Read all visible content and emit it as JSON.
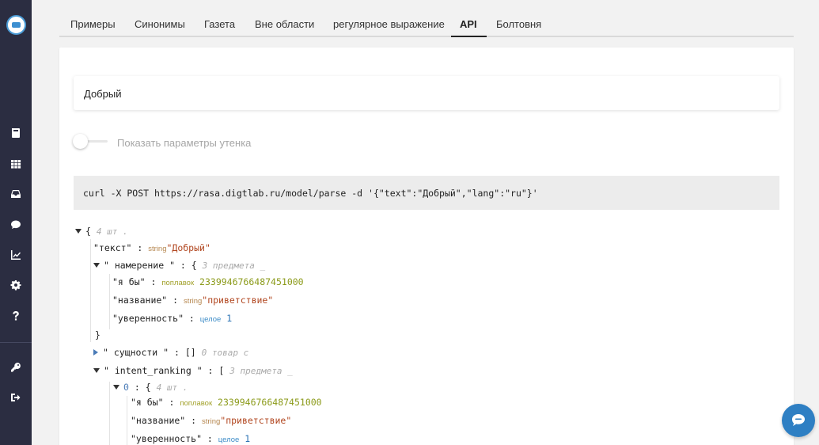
{
  "sidebar": {
    "icons": [
      "logo-icon",
      "book-icon",
      "grid-icon",
      "inbox-icon",
      "chat-icon",
      "chart-icon",
      "gear-icon",
      "help-icon",
      "key-icon",
      "logout-icon"
    ]
  },
  "tabs": [
    {
      "label": "Примеры"
    },
    {
      "label": "Синонимы"
    },
    {
      "label": "Газета"
    },
    {
      "label": "Вне области"
    },
    {
      "label": "регулярное выражение"
    },
    {
      "label": "API"
    },
    {
      "label": "Болтовня"
    }
  ],
  "active_tab": "API",
  "input": {
    "value": "Добрый"
  },
  "toggle": {
    "label": "Показать параметры утенка",
    "checked": false
  },
  "curl": {
    "command": "curl -X POST https://rasa.digtlab.ru/model/parse -d '{\"text\":\"Добрый\",\"lang\":\"ru\"}'"
  },
  "json": {
    "root_brace": "{",
    "root_meta": "4 шт .",
    "text_key": "\"текст\" :",
    "text_type": "string",
    "text_value": "\"Добрый\"",
    "intent_key": "\" намерение \" : {",
    "intent_meta": "3 предмета _",
    "intent_id_key": "\"я бы\" :",
    "intent_id_type": "поплавок",
    "intent_id_value": "2339946766487451000",
    "intent_name_key": "\"название\" :",
    "intent_name_type": "string",
    "intent_name_value": "\"приветствие\"",
    "intent_conf_key": "\"уверенность\" :",
    "intent_conf_type": "целое",
    "intent_conf_value": "1",
    "intent_close": "}",
    "entities_key": "\" сущности \" : []",
    "entities_meta": "0 товар с",
    "ranking_key": "\" intent_ranking \" : [",
    "ranking_meta": "3 предмета _",
    "item0_key": "0",
    "item0_brace": ": {",
    "item0_meta": "4 шт .",
    "item0_id_key": "\"я бы\" :",
    "item0_id_type": "поплавок",
    "item0_id_value": "2339946766487451000",
    "item0_name_key": "\"название\" :",
    "item0_name_type": "string",
    "item0_name_value": "\"приветствие\"",
    "item0_conf_key": "\"уверенность\" :",
    "item0_conf_type": "целое",
    "item0_conf_value": "1"
  },
  "colors": {
    "sidebar": "#2b2d41",
    "accent": "#2e7fc3",
    "string_value": "#b1461f",
    "float_value": "#8b9a19",
    "int_value": "#2b73b4"
  }
}
